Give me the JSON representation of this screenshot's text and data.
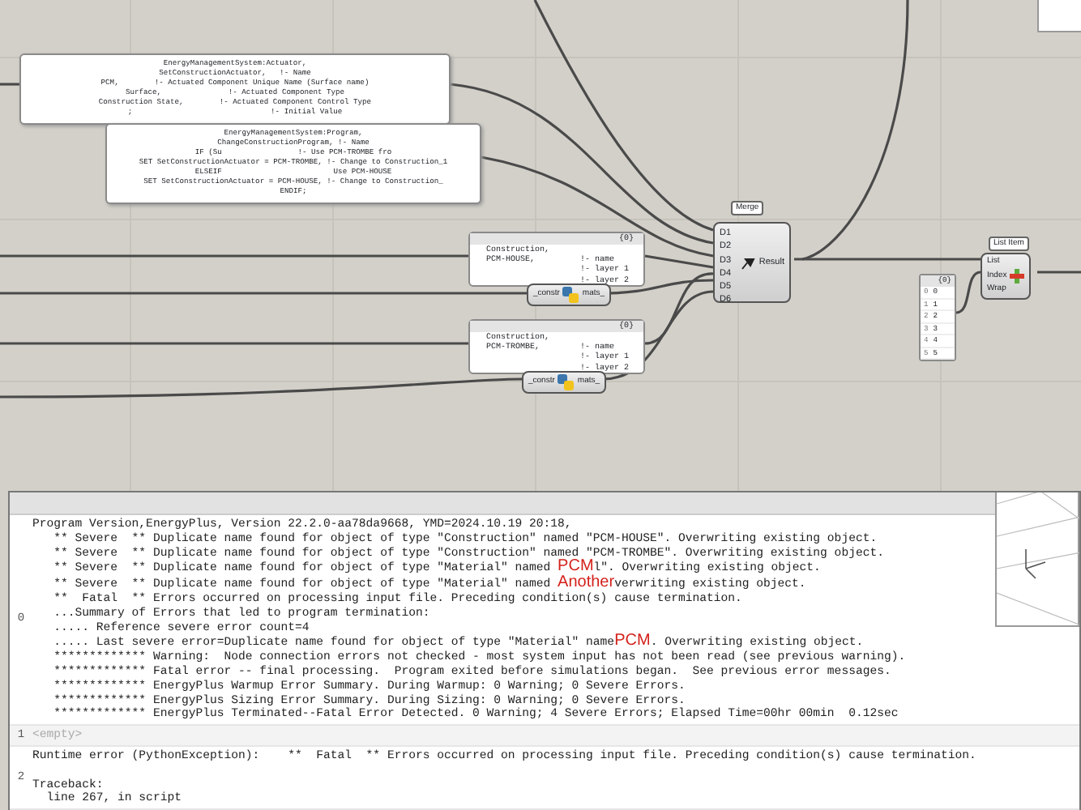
{
  "canvas": {
    "text_panels": [
      {
        "lines": [
          "EnergyManagementSystem:Actuator,",
          "SetConstructionActuator,   !- Name",
          "PCM,        !- Actuated Component Unique Name (Surface name)",
          "Surface,               !- Actuated Component Type",
          "Construction State,        !- Actuated Component Control Type",
          ";                               !- Initial Value"
        ]
      },
      {
        "lines": [
          "EnergyManagementSystem:Program,",
          "ChangeConstructionProgram, !- Name",
          "IF (Su                 !- Use PCM-TROMBE fro",
          "SET SetConstructionActuator = PCM-TROMBE, !- Change to Construction_1",
          "ELSEIF                         Use PCM-HOUSE",
          "SET SetConstructionActuator = PCM-HOUSE, !- Change to Construction_",
          "ENDIF;"
        ]
      }
    ],
    "construction_panels": [
      {
        "header": "{0}",
        "rows": [
          {
            "code": "Construction,"
          },
          {
            "code": "PCM-HOUSE,",
            "comment": "!- name"
          },
          {
            "comment": "!- layer 1"
          },
          {
            "comment": "!- layer 2"
          }
        ]
      },
      {
        "header": "{0}",
        "rows": [
          {
            "code": "Construction,"
          },
          {
            "code": "PCM-TROMBE,",
            "comment": "!- name"
          },
          {
            "comment": "!- layer 1"
          },
          {
            "comment": "!- layer 2"
          }
        ]
      }
    ],
    "python_components": [
      {
        "input": "_constr",
        "output": "mats_"
      },
      {
        "input": "_constr",
        "output": "mats_"
      }
    ],
    "merge": {
      "label": "Merge",
      "inputs": [
        "D1",
        "D2",
        "D3",
        "D4",
        "D5",
        "D6"
      ],
      "output": "Result"
    },
    "list_item": {
      "label": "List Item",
      "inputs": [
        "List",
        "Index",
        "Wrap"
      ]
    },
    "number_panel": {
      "header": "{0}",
      "items": [
        {
          "index": "0",
          "value": "0"
        },
        {
          "index": "1",
          "value": "1"
        },
        {
          "index": "2",
          "value": "2"
        },
        {
          "index": "3",
          "value": "3"
        },
        {
          "index": "4",
          "value": "4"
        },
        {
          "index": "5",
          "value": "5"
        }
      ]
    }
  },
  "output_panel": {
    "items": [
      {
        "index": "0",
        "kind": "text",
        "paragraphs": [
          [
            {
              "text": "Program Version,EnergyPlus, Version 22.2.0-aa78da9668, YMD=2024.10.19 20:18,"
            },
            {
              "text": "   ** Severe  ** Duplicate name found for object of type \"Construction\" named \"PCM-HOUSE\". Overwriting existing object."
            },
            {
              "text": "   ** Severe  ** Duplicate name found for object of type \"Construction\" named \"PCM-TROMBE\". Overwriting existing object."
            },
            {
              "text": "   ** Severe  ** Duplicate name found for object of type \"Material\" named ",
              "note": "PCM",
              "rest": "l\". Overwriting existing object."
            },
            {
              "text": "   ** Severe  ** Duplicate name found for object of type \"Material\" named ",
              "note": "Another",
              "rest": "verwriting existing object."
            },
            {
              "text": "   **  Fatal  ** Errors occurred on processing input file. Preceding condition(s) cause termination."
            },
            {
              "text": "   ...Summary of Errors that led to program termination:"
            },
            {
              "text": "   ..... Reference severe error count=4"
            },
            {
              "text": "   ..... Last severe error=Duplicate name found for object of type \"Material\" name",
              "note": "PCM",
              "rest": ". Overwriting existing object."
            },
            {
              "text": "   ************* Warning:  Node connection errors not checked - most system input has not been read (see previous warning)."
            },
            {
              "text": "   ************* Fatal error -- final processing.  Program exited before simulations began.  See previous error messages."
            },
            {
              "text": "   ************* EnergyPlus Warmup Error Summary. During Warmup: 0 Warning; 0 Severe Errors."
            },
            {
              "text": "   ************* EnergyPlus Sizing Error Summary. During Sizing: 0 Warning; 0 Severe Errors."
            },
            {
              "text": "   ************* EnergyPlus Terminated--Fatal Error Detected. 0 Warning; 4 Severe Errors; Elapsed Time=00hr 00min  0.12sec"
            }
          ]
        ]
      },
      {
        "index": "1",
        "kind": "empty",
        "paragraphs": [
          [
            {
              "text": "<empty>"
            }
          ]
        ]
      },
      {
        "index": "2",
        "kind": "text",
        "paragraphs": [
          [
            {
              "text": "Runtime error (PythonException):    **  Fatal  ** Errors occurred on processing input file. Preceding condition(s) cause termination."
            }
          ],
          [
            {
              "text": "Traceback:"
            },
            {
              "text": "  line 267, in script"
            }
          ]
        ]
      }
    ]
  }
}
